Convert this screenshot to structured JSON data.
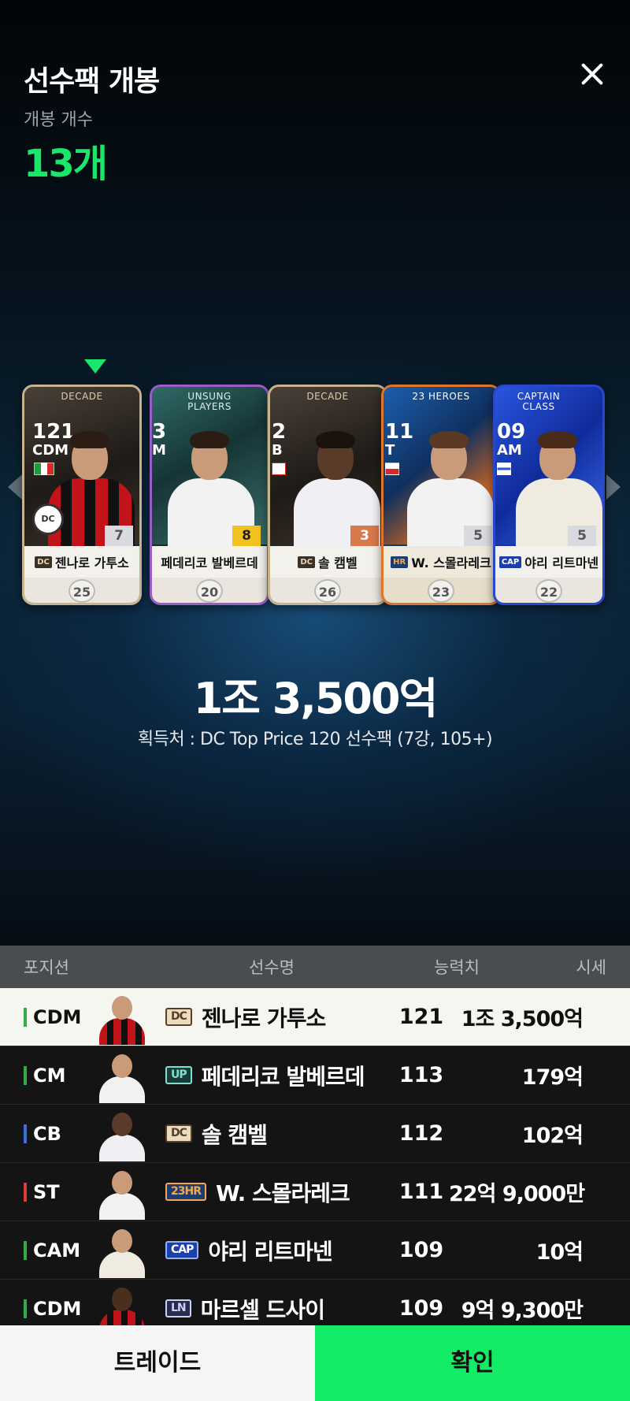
{
  "header": {
    "title": "선수팩 개봉",
    "open_count_label": "개봉 개수",
    "open_count": "13개"
  },
  "cards": [
    {
      "program": "DECADE",
      "ovr": "121",
      "position": "CDM",
      "grade": "7",
      "badge": "DC",
      "name": "젠나로 가투소",
      "price_level": "25"
    },
    {
      "program": "UNSUNG\nPLAYERS",
      "ovr": "3",
      "position": "M",
      "grade": "8",
      "badge": "",
      "name": "페데리코 발베르데",
      "price_level": "20"
    },
    {
      "program": "DECADE",
      "ovr": "2",
      "position": "B",
      "grade": "3",
      "badge": "DC",
      "name": "솔 캠벨",
      "price_level": "26"
    },
    {
      "program": "23 HEROES",
      "ovr": "11",
      "position": "T",
      "grade": "5",
      "badge": "HR",
      "name": "W. 스몰라레크",
      "price_level": "23"
    },
    {
      "program": "CAPTAIN\nCLASS",
      "ovr": "09",
      "position": "AM",
      "grade": "5",
      "badge": "CAP",
      "name": "야리 리트마넨",
      "price_level": "22"
    }
  ],
  "selected_price": "1조 3,500억",
  "source": "획득처 : DC Top Price 120 선수팩 (7강, 105+)",
  "table": {
    "headers": {
      "position": "포지션",
      "name": "선수명",
      "ovr": "능력치",
      "price": "시세"
    },
    "rows": [
      {
        "position": "CDM",
        "badge": "DC",
        "name": "젠나로 가투소",
        "ovr": "121",
        "price": "1조 3,500억"
      },
      {
        "position": "CM",
        "badge": "UP",
        "name": "페데리코 발베르데",
        "ovr": "113",
        "price": "179억"
      },
      {
        "position": "CB",
        "badge": "DC",
        "name": "솔 캠벨",
        "ovr": "112",
        "price": "102억"
      },
      {
        "position": "ST",
        "badge": "23HR",
        "name": "W. 스몰라레크",
        "ovr": "111",
        "price": "22억 9,000만"
      },
      {
        "position": "CAM",
        "badge": "CAP",
        "name": "야리 리트마넨",
        "ovr": "109",
        "price": "10억"
      },
      {
        "position": "CDM",
        "badge": "LN",
        "name": "마르셀 드사이",
        "ovr": "109",
        "price": "9억 9,300만"
      }
    ]
  },
  "footer": {
    "trade_label": "트레이드",
    "confirm_label": "확인"
  },
  "colors": {
    "accent_green": "#19e66a",
    "pos_mid": "#2fae4a",
    "pos_def": "#3b6fe0",
    "pos_att": "#e03b3b"
  }
}
